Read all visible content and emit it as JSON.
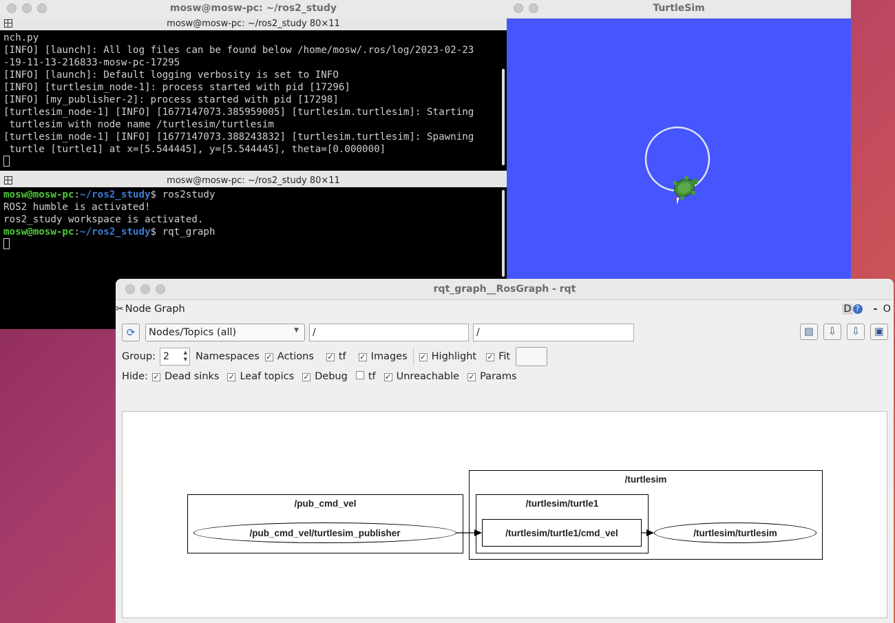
{
  "terminal": {
    "window_title": "mosw@mosw-pc: ~/ros2_study",
    "pane1_title": "mosw@mosw-pc: ~/ros2_study 80×11",
    "pane1_lines": [
      "nch.py",
      "[INFO] [launch]: All log files can be found below /home/mosw/.ros/log/2023-02-23",
      "-19-11-13-216833-mosw-pc-17295",
      "[INFO] [launch]: Default logging verbosity is set to INFO",
      "[INFO] [turtlesim_node-1]: process started with pid [17296]",
      "[INFO] [my_publisher-2]: process started with pid [17298]",
      "[turtlesim_node-1] [INFO] [1677147073.385959005] [turtlesim.turtlesim]: Starting",
      " turtlesim with node name /turtlesim/turtlesim",
      "[turtlesim_node-1] [INFO] [1677147073.388243832] [turtlesim.turtlesim]: Spawning",
      " turtle [turtle1] at x=[5.544445], y=[5.544445], theta=[0.000000]"
    ],
    "pane2_title": "mosw@mosw-pc: ~/ros2_study 80×11",
    "prompt_user": "mosw@mosw-pc",
    "prompt_sep": ":",
    "prompt_path": "~/ros2_study",
    "prompt_dollar": "$ ",
    "cmd1": "ros2study",
    "out1": "ROS2 humble is activated!",
    "out2": "ros2_study workspace is activated.",
    "cmd2": "rqt_graph"
  },
  "turtlesim": {
    "window_title": "TurtleSim",
    "background_color": "#4556ff",
    "path_color": "#d9dcf2"
  },
  "rqt": {
    "window_title": "rqt_graph__RosGraph - rqt",
    "plugin_title": "Node Graph",
    "right_controls": {
      "d": "D",
      "help": "?",
      "dash": "-",
      "o": "O"
    },
    "mode_select": "Nodes/Topics (all)",
    "filter1": "/",
    "filter2": "/",
    "group_label": "Group:",
    "group_value": "2",
    "row1": {
      "namespaces": "Namespaces",
      "actions": "Actions",
      "tf": "tf",
      "images": "Images",
      "highlight": "Highlight",
      "fit": "Fit"
    },
    "row2": {
      "hide": "Hide:",
      "dead_sinks": "Dead sinks",
      "leaf_topics": "Leaf topics",
      "debug": "Debug",
      "tf": "tf",
      "unreachable": "Unreachable",
      "params": "Params"
    },
    "checks": {
      "namespaces": true,
      "actions": true,
      "tf": true,
      "images": true,
      "highlight": true,
      "fit": true,
      "dead_sinks": true,
      "leaf_topics": true,
      "debug": true,
      "hide_tf": false,
      "unreachable": true,
      "params": true
    },
    "graph": {
      "cluster_pub": "/pub_cmd_vel",
      "node_pub": "/pub_cmd_vel/turtlesim_publisher",
      "cluster_turtlesim": "/turtlesim",
      "cluster_turtle1": "/turtlesim/turtle1",
      "topic_cmd_vel": "/turtlesim/turtle1/cmd_vel",
      "node_turtlesim": "/turtlesim/turtlesim"
    }
  }
}
